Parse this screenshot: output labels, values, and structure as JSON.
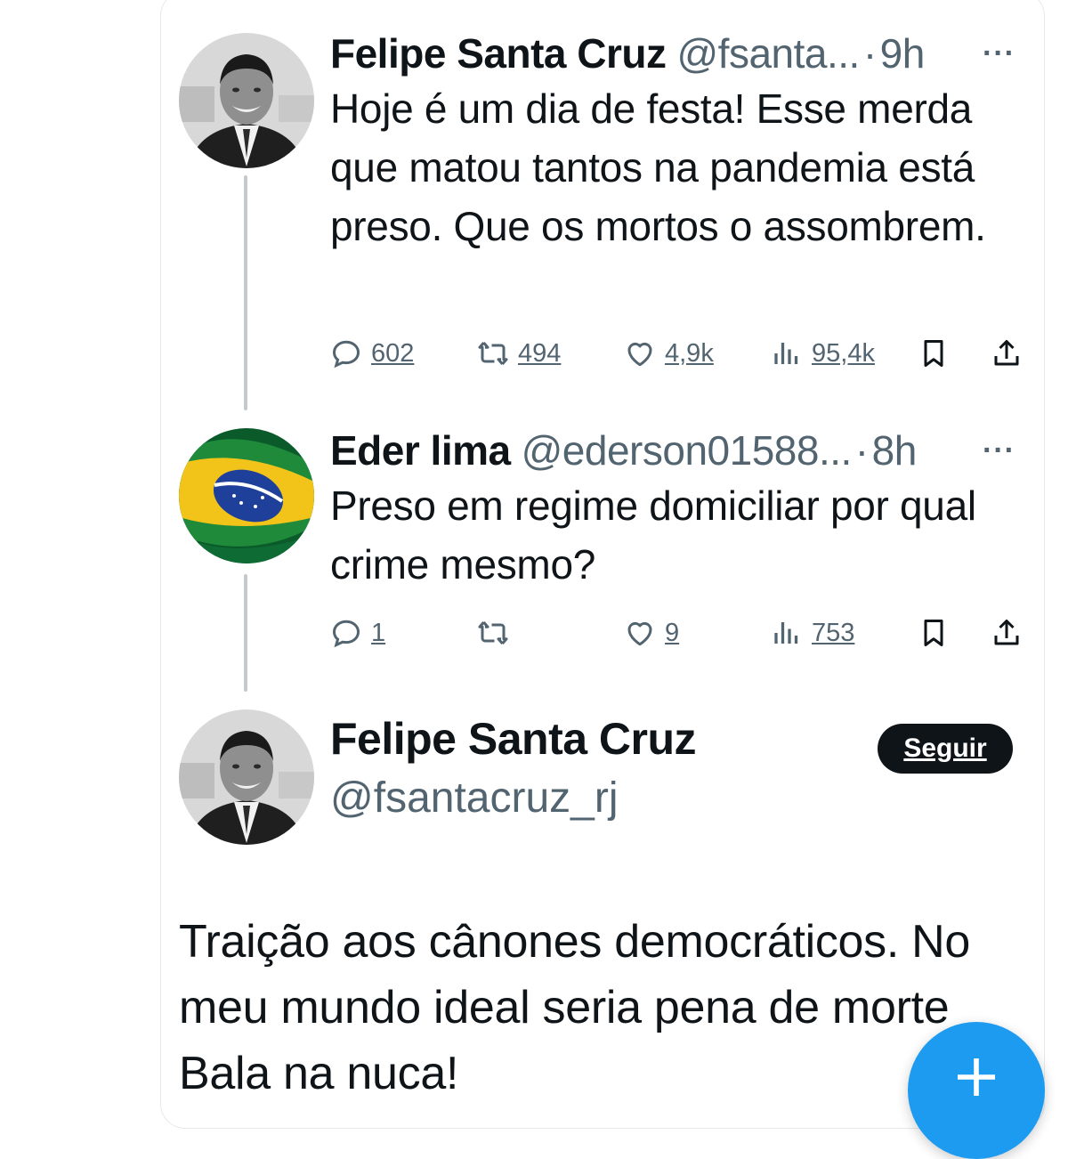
{
  "tweets": [
    {
      "name": "Felipe Santa Cruz",
      "handle": "@fsanta...",
      "time": "9h",
      "text": "Hoje é um dia de festa! Esse merda que matou tantos na pandemia está preso. Que os mortos o assombrem.",
      "replies": "602",
      "retweets": "494",
      "likes": "4,9k",
      "views": "95,4k"
    },
    {
      "name": "Eder lima",
      "handle": "@ederson01588...",
      "time": "8h",
      "text": "Preso em regime domiciliar por qual crime mesmo?",
      "replies": "1",
      "retweets": "",
      "likes": "9",
      "views": "753"
    }
  ],
  "main_tweet": {
    "name": "Felipe Santa Cruz",
    "handle": "@fsantacruz_rj",
    "follow_label": "Seguir",
    "text_lines": [
      "Traição aos cânones democráticos. No",
      "meu mundo ideal seria pena de morte",
      "Bala na nuca!"
    ]
  },
  "dot": "·",
  "more": "···",
  "colors": {
    "accent": "#1d9bf0",
    "muted": "#536471",
    "text": "#0f1419"
  },
  "icons": [
    "reply-icon",
    "retweet-icon",
    "like-icon",
    "views-icon",
    "bookmark-icon",
    "share-icon",
    "plus-icon"
  ]
}
